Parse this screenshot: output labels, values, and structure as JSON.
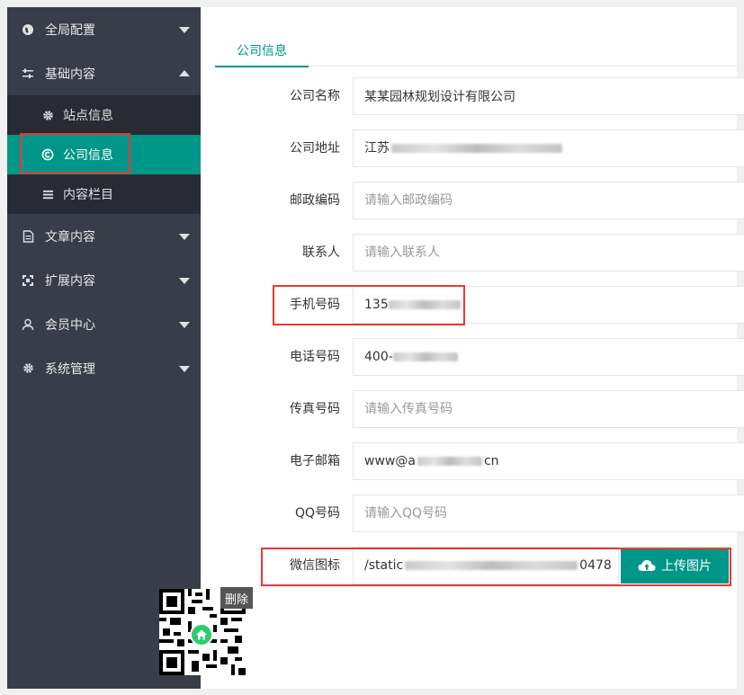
{
  "sidebar": {
    "items": [
      {
        "label": "全局配置",
        "icon": "globe-icon"
      },
      {
        "label": "基础内容",
        "icon": "sliders-icon"
      },
      {
        "label": "文章内容",
        "icon": "document-icon"
      },
      {
        "label": "扩展内容",
        "icon": "expand-icon"
      },
      {
        "label": "会员中心",
        "icon": "user-icon"
      },
      {
        "label": "系统管理",
        "icon": "gear-icon"
      }
    ],
    "submenu": [
      {
        "label": "站点信息",
        "icon": "gear-icon"
      },
      {
        "label": "公司信息",
        "icon": "copyright-icon"
      },
      {
        "label": "内容栏目",
        "icon": "menu-icon"
      }
    ]
  },
  "tab": {
    "label": "公司信息"
  },
  "form": {
    "company_name": {
      "label": "公司名称",
      "value": "某某园林规划设计有限公司"
    },
    "company_address": {
      "label": "公司地址",
      "value": "江苏"
    },
    "postcode": {
      "label": "邮政编码",
      "placeholder": "请输入邮政编码"
    },
    "contact": {
      "label": "联系人",
      "placeholder": "请输入联系人"
    },
    "mobile": {
      "label": "手机号码",
      "value": "135"
    },
    "phone": {
      "label": "电话号码",
      "value": "400-"
    },
    "fax": {
      "label": "传真号码",
      "placeholder": "请输入传真号码"
    },
    "email": {
      "label": "电子邮箱",
      "value_prefix": "www@a",
      "value_suffix": "cn"
    },
    "qq": {
      "label": "QQ号码",
      "placeholder": "请输入QQ号码"
    },
    "wechat": {
      "label": "微信图标",
      "value_prefix": "/static",
      "value_suffix": "0478",
      "upload_label": "上传图片",
      "delete_label": "删除"
    }
  },
  "colors": {
    "accent": "#009688",
    "sidebar_bg": "#393d49",
    "submenu_bg": "#282b33",
    "highlight_border": "#e53935"
  }
}
